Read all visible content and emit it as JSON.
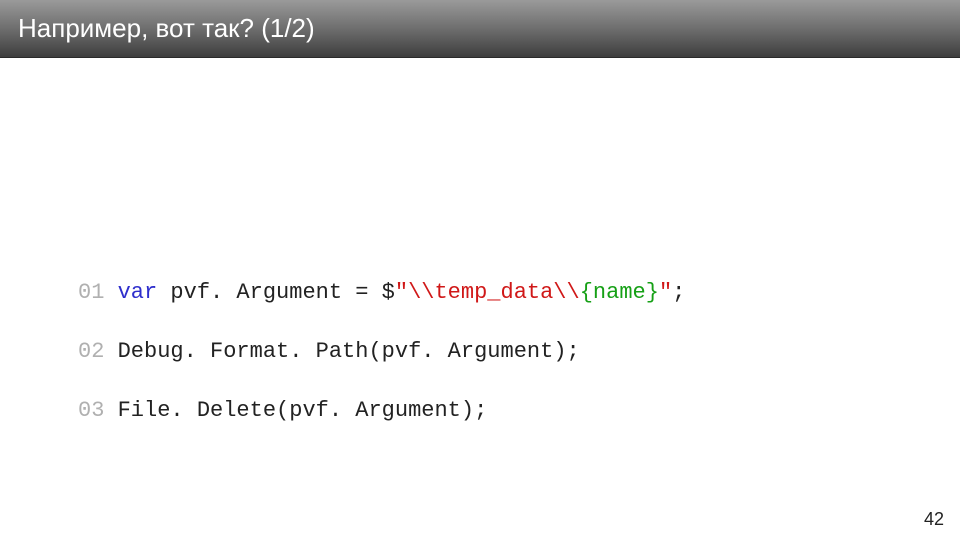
{
  "title": "Например, вот так? (1/2)",
  "page_number": "42",
  "code": {
    "lines": [
      {
        "num": "01",
        "t": [
          "var",
          " pvf. Argument ",
          "= $",
          "\"\\\\temp_data\\\\",
          "{name}",
          "\"",
          ";"
        ]
      },
      {
        "num": "02",
        "t": [
          "Debug. Format",
          ". ",
          "Path",
          "(",
          "pvf. Argument",
          ")",
          "",
          ";"
        ]
      },
      {
        "num": "03",
        "t": [
          "File",
          ". ",
          "Delete",
          "(",
          "pvf. Argument",
          ");"
        ]
      }
    ]
  }
}
